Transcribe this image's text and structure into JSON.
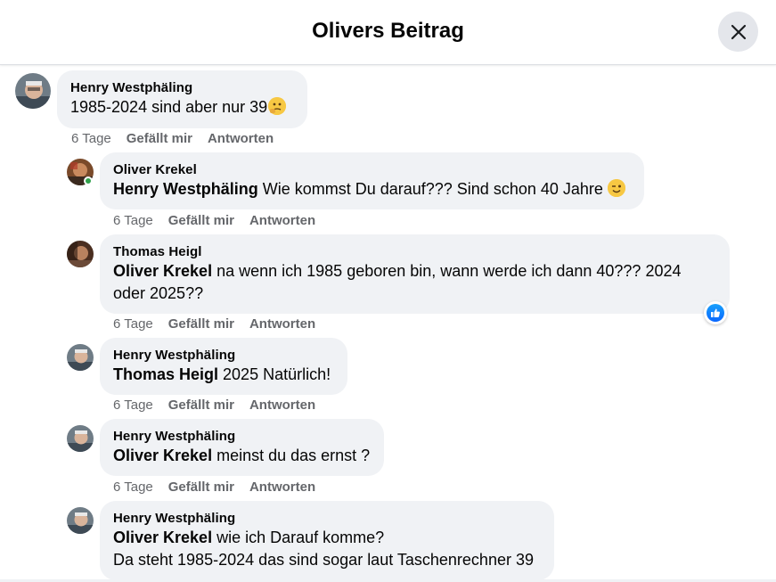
{
  "header": {
    "title": "Olivers Beitrag",
    "close_icon": "close-icon"
  },
  "colors": {
    "bubble": "#f0f2f5",
    "meta": "#65676b",
    "like": "#0866ff",
    "online": "#31a24c"
  },
  "comments": [
    {
      "author": "Henry Westphäling",
      "lines": [
        {
          "mention": "",
          "text": "1985-2024 sind aber nur 39"
        }
      ],
      "emoji": "thinking-face",
      "time": "6 Tage",
      "like": "Gefällt mir",
      "reply": "Antworten"
    },
    {
      "author": "Oliver Krekel",
      "lines": [
        {
          "mention": "Henry Westphäling",
          "text": " Wie kommst Du darauf??? Sind schon 40 Jahre "
        }
      ],
      "emoji": "winking-face",
      "time": "6 Tage",
      "like": "Gefällt mir",
      "reply": "Antworten"
    },
    {
      "author": "Thomas Heigl",
      "lines": [
        {
          "mention": "Oliver Krekel",
          "text": " na wenn ich 1985 geboren bin, wann werde ich dann 40??? 2024"
        },
        {
          "mention": "",
          "text": "oder 2025??"
        }
      ],
      "reaction": "like",
      "time": "6 Tage",
      "like": "Gefällt mir",
      "reply": "Antworten"
    },
    {
      "author": "Henry Westphäling",
      "lines": [
        {
          "mention": "Thomas Heigl",
          "text": " 2025 Natürlich!"
        }
      ],
      "time": "6 Tage",
      "like": "Gefällt mir",
      "reply": "Antworten"
    },
    {
      "author": "Henry Westphäling",
      "lines": [
        {
          "mention": "Oliver Krekel",
          "text": " meinst du das ernst ?"
        }
      ],
      "time": "6 Tage",
      "like": "Gefällt mir",
      "reply": "Antworten"
    },
    {
      "author": "Henry Westphäling",
      "lines": [
        {
          "mention": "Oliver Krekel",
          "text": " wie ich Darauf komme?"
        },
        {
          "mention": "",
          "text": "Da steht 1985-2024 das sind sogar laut Taschenrechner 39"
        }
      ]
    }
  ]
}
